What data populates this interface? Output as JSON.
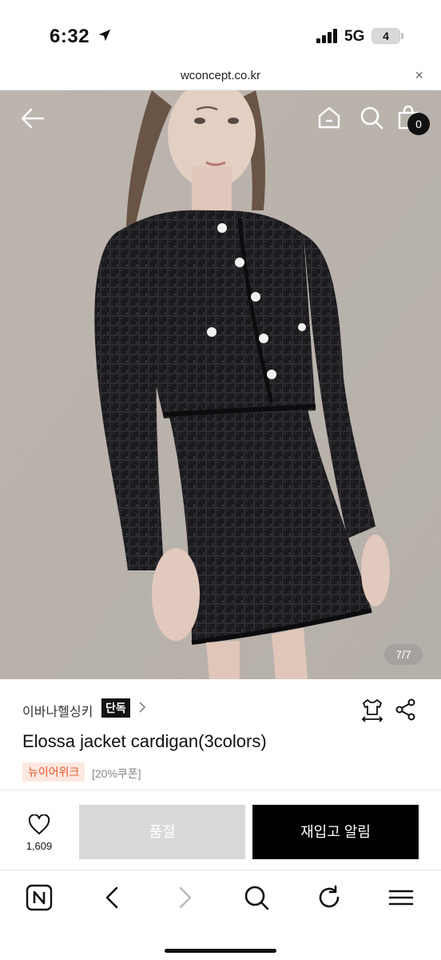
{
  "status_bar": {
    "time": "6:32",
    "network": "5G",
    "battery": "4"
  },
  "browser": {
    "url": "wconcept.co.kr",
    "close_glyph": "×"
  },
  "header_icons": [
    "back-arrow-icon",
    "home-icon",
    "search-icon",
    "shopping-bag-icon"
  ],
  "cart": {
    "count": "0"
  },
  "image_counter": "7/7",
  "product": {
    "brand": "이바나헬싱키",
    "exclusive_badge": "단독",
    "title": "Elossa jacket cardigan(3colors)",
    "tag": "뉴이어위크",
    "coupon": "[20%쿠폰]"
  },
  "actions": {
    "like_count": "1,609",
    "soldout_label": "품절",
    "notify_label": "재입고 알림"
  },
  "colors": {
    "accent_tag_text": "#e8542a",
    "accent_tag_bg": "#fde8e0",
    "soldout_bg": "#d9d9d9",
    "primary_button": "#000000"
  },
  "toolbar_icons": [
    "naver-n-icon",
    "back-chevron-icon",
    "forward-chevron-icon",
    "search-icon",
    "reload-icon",
    "menu-icon"
  ]
}
